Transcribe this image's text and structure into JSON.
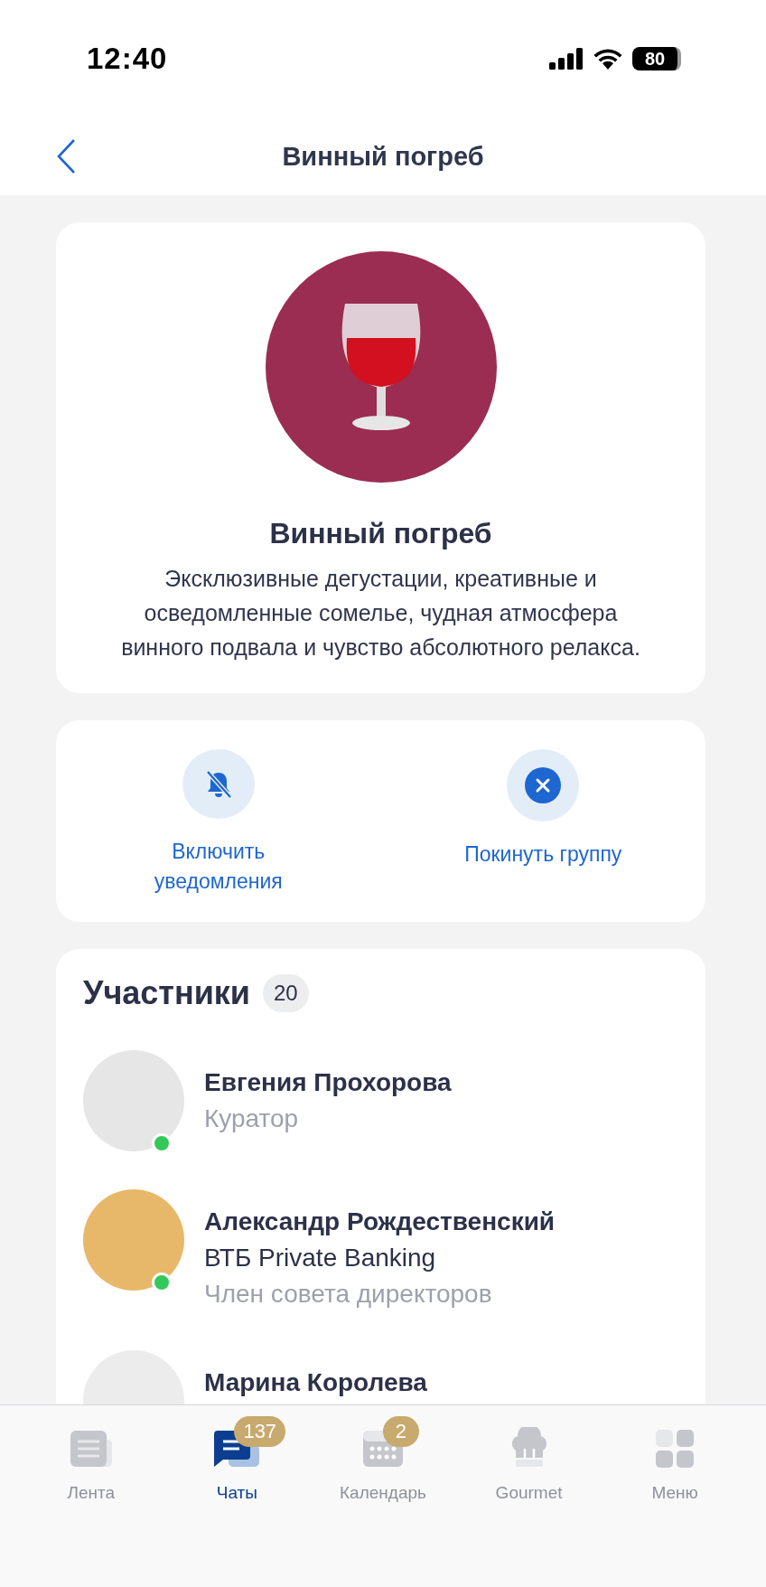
{
  "status_bar": {
    "time": "12:40",
    "battery": "80"
  },
  "header": {
    "title": "Винный погреб"
  },
  "group": {
    "name": "Винный погреб",
    "description": "Эксклюзивные дегустации, креативные и осведомленные сомелье, чудная атмосфера винного подвала и чувство абсолютного релакса."
  },
  "actions": [
    {
      "kind": "notify",
      "label": "Включить уведомления"
    },
    {
      "kind": "leave",
      "label": "Покинуть группу"
    }
  ],
  "members_section": {
    "title": "Участники",
    "count": "20",
    "members": [
      {
        "name": "Евгения Прохорова",
        "role": "Куратор",
        "online": true,
        "color": "#e6e6e6"
      },
      {
        "name": "Александр Рождественский",
        "company": "ВТБ Private Banking",
        "role": "Член совета директоров",
        "online": true,
        "color": "#e8b86a"
      },
      {
        "name": "Марина Королева",
        "color": "#ececec"
      }
    ]
  },
  "tab_bar": [
    {
      "kind": "feed",
      "label": "Лента",
      "selected": false
    },
    {
      "kind": "chats",
      "label": "Чаты",
      "selected": true,
      "badge": "137"
    },
    {
      "kind": "calendar",
      "label": "Календарь",
      "selected": false,
      "badge": "2"
    },
    {
      "kind": "gourmet",
      "label": "Gourmet",
      "selected": false
    },
    {
      "kind": "menu",
      "label": "Меню",
      "selected": false
    }
  ]
}
